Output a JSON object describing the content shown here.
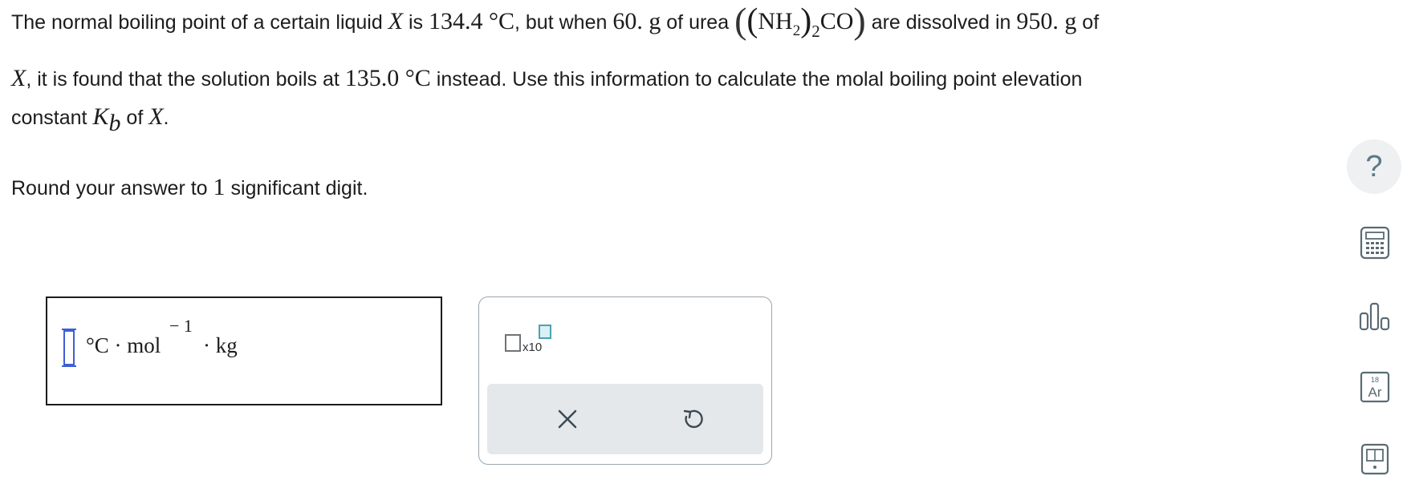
{
  "question": {
    "line1": {
      "t1": "The normal boiling point of a certain liquid ",
      "var_x": "X",
      "t2": " is ",
      "bp_value": "134.4 °C",
      "t3": ", but when ",
      "mass_solute": "60. g",
      "t4": " of urea ",
      "urea_nh": "NH",
      "urea_h_sub": "2",
      "urea_outer_sub": "2",
      "urea_co": "CO",
      "t5": " are dissolved in ",
      "mass_solvent": "950. g",
      "t6": " of"
    },
    "line2": {
      "var_x": "X",
      "t1": ", it is found that the solution boils at ",
      "bp_solution": "135.0 °C",
      "t2": " instead. Use this information to calculate the molal boiling point elevation"
    },
    "line3": {
      "t1": "constant ",
      "k": "K",
      "k_sub": "b",
      "t2": " of ",
      "var_x": "X",
      "t3": "."
    },
    "line4": {
      "t1": "Round your answer to ",
      "sig": "1",
      "t2": " significant digit."
    }
  },
  "answer": {
    "value": "",
    "unit_c_mol": "°C · mol",
    "unit_exp": "− 1",
    "unit_kg": "· kg"
  },
  "keypad": {
    "sci_label": "x10",
    "clear_icon": "close-icon",
    "undo_icon": "undo-icon"
  },
  "toolbar": {
    "help_label": "?",
    "calculator_icon": "calculator-icon",
    "data_icon": "bar-chart-icon",
    "periodic_icon": "periodic-table-icon",
    "periodic_number": "18",
    "periodic_symbol": "Ar",
    "reference_icon": "reference-book-icon"
  }
}
